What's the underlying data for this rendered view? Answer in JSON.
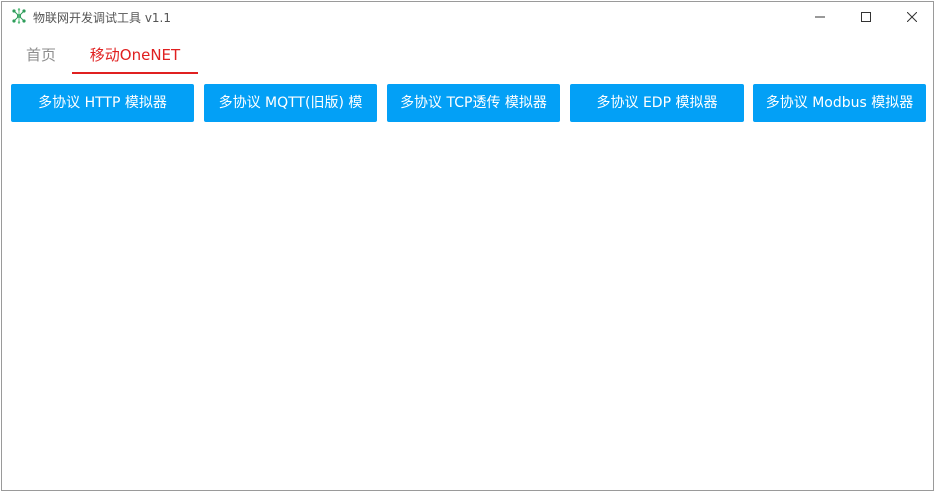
{
  "window": {
    "title": "物联网开发调试工具 v1.1",
    "controls": {
      "minimize": "─",
      "maximize": "☐",
      "close": "✕"
    }
  },
  "tabs": [
    {
      "label": "首页",
      "active": false
    },
    {
      "label": "移动OneNET",
      "active": true
    }
  ],
  "buttons": [
    {
      "label": "多协议 HTTP 模拟器"
    },
    {
      "label": "多协议 MQTT(旧版) 模"
    },
    {
      "label": "多协议 TCP透传 模拟器"
    },
    {
      "label": "多协议 EDP 模拟器"
    },
    {
      "label": "多协议 Modbus 模拟器"
    }
  ],
  "colors": {
    "accent_button": "#03a0f6",
    "active_tab": "#e02020",
    "inactive_tab": "#8e8e8e",
    "icon_green": "#2e9d5a"
  }
}
